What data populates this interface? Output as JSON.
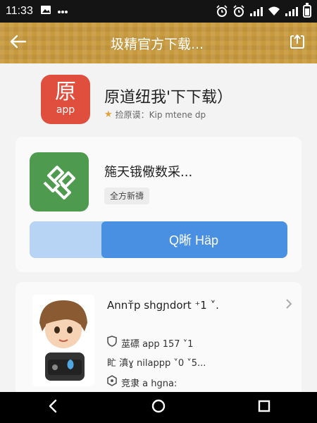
{
  "status_bar": {
    "time": "11:33",
    "left_icons": [
      "image-icon",
      "more-dots-icon"
    ],
    "right_icons": [
      "alarm-icon",
      "alarm-icon",
      "signal-icon",
      "wifi-icon",
      "signal-icon",
      "battery-icon"
    ]
  },
  "header": {
    "title": "圾精官方下载...",
    "back_icon": "arrow-left-icon",
    "share_icon": "share-icon",
    "color": "#c89a3e"
  },
  "app": {
    "logo_char": "原",
    "logo_sub": "app",
    "logo_color": "#e04f3e",
    "name": "原道纽我'下下载）",
    "meta": "捡原谟：Kip mtene dp"
  },
  "download_card": {
    "app_name": "箷天锇儆数采...",
    "tag": "全方新禱",
    "button_label": "Q晰 Häp",
    "icon_color": "#4e9a4e",
    "button_color": "#4a90e2",
    "progress": 0.72
  },
  "user_card": {
    "name": "Annт̆p shgɲdort  ⁺1  ˅.",
    "rows": [
      {
        "icon": "shield-icon",
        "text": "莁磦 app 157 ˅1"
      },
      {
        "icon": "ring-icon",
        "text": "盳 滇ɣ nilappp ˅0 ˅5..."
      },
      {
        "icon": "hexagon-icon",
        "text": "竞隶 a hgna:"
      }
    ]
  },
  "nav": {
    "icons": [
      "back-triangle-icon",
      "home-circle-icon",
      "recents-square-icon"
    ]
  }
}
